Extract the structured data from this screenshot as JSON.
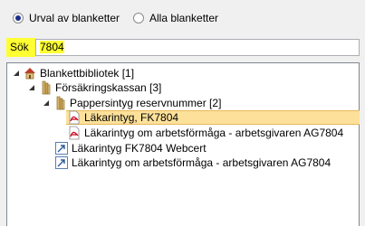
{
  "radios": {
    "option1": {
      "label": "Urval av blanketter",
      "checked": true
    },
    "option2": {
      "label": "Alla blanketter",
      "checked": false
    }
  },
  "search": {
    "label": "Sök",
    "value": "7804"
  },
  "tree": {
    "nodes": [
      {
        "label": "Blankettbibliotek [1]",
        "icon": "library-house-icon",
        "expanded": true
      },
      {
        "label": "Försäkringskassan [3]",
        "icon": "folder-books-icon",
        "expanded": true
      },
      {
        "label": "Pappersintyg reservnummer [2]",
        "icon": "folder-books-icon",
        "expanded": true
      },
      {
        "label": "Läkarintyg, FK7804",
        "icon": "pdf-document-icon",
        "selected": true
      },
      {
        "label": "Läkarintyg om arbetsförmåga  - arbetsgivaren AG7804",
        "icon": "pdf-document-icon"
      },
      {
        "label": "Läkarintyg FK7804 Webcert",
        "icon": "link-arrow-icon"
      },
      {
        "label": "Läkarintyg om arbetsförmåga  - arbetsgivaren AG7804",
        "icon": "link-arrow-icon"
      }
    ]
  },
  "colors": {
    "highlight": "#ffff33",
    "selection": "#fde19a",
    "radio_dot": "#1a2d8a"
  }
}
